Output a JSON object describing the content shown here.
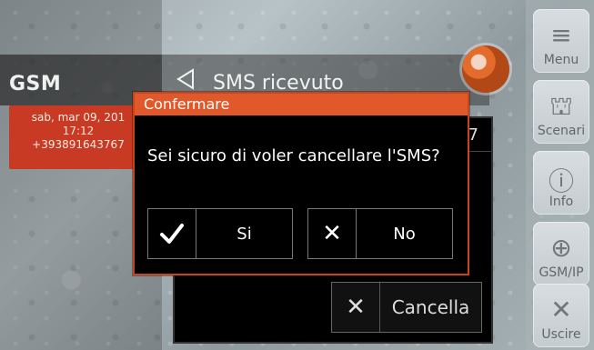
{
  "left_panel": {
    "title": "GSM",
    "sms_entry": {
      "date": "sab, mar 09, 201",
      "time": "17:12",
      "number": "+393891643767"
    }
  },
  "header": {
    "title": "SMS ricevuto"
  },
  "sms_view": {
    "number_fragment": "7",
    "cancel_label": "Cancella",
    "cancel_icon": "x-icon"
  },
  "confirm_dialog": {
    "title": "Confermare",
    "message": "Sei sicuro di voler cancellare l'SMS?",
    "yes_label": "Si",
    "no_label": "No",
    "yes_icon": "checkmark-icon",
    "no_icon": "x-icon",
    "colors": {
      "header": "#e1582a",
      "border": "#c6451d"
    }
  },
  "sidebar": {
    "items": [
      {
        "label": "Menu",
        "icon": "menu-icon"
      },
      {
        "label": "Scenari",
        "icon": "scenari-icon"
      },
      {
        "label": "Info",
        "icon": "info-icon"
      },
      {
        "label": "GSM/IP",
        "icon": "globe-icon"
      },
      {
        "label": "Uscire",
        "icon": "exit-icon"
      }
    ]
  }
}
